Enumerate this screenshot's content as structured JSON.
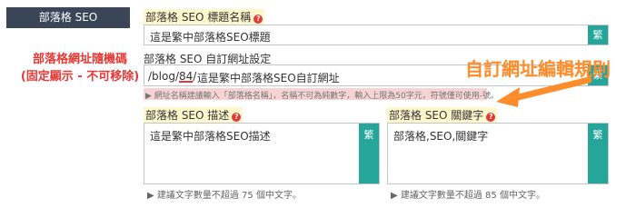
{
  "sidebar": {
    "tab_label": "部落格 SEO",
    "note_line1": "部落格網址隨機碼",
    "note_line2": "(固定顯示 - 不可移除)"
  },
  "title_field": {
    "label": "部落格 SEO 標題名稱",
    "value": "這是繁中部落格SEO標題",
    "button": "繁"
  },
  "url_field": {
    "label": "部落格 SEO 自訂網址設定",
    "prefix_start": "/blog/",
    "prefix_code": "84",
    "prefix_end": "/",
    "value": "這是繁中部落格SEO自訂網址",
    "button": "繁",
    "hint": "▶ 網址名稱建議輸入「部落格名稱」，名稱不可為純數字，輸入上限為50字元，符號僅可使用-號。"
  },
  "annotation": {
    "callout": "自訂網址編輯規則",
    "color": "#ff8c2a"
  },
  "desc_field": {
    "label": "部落格 SEO 描述",
    "value": "這是繁中部落格SEO描述",
    "button": "繁",
    "hint": "▶ 建議文字數量不超過 75 個中文字。"
  },
  "keywords_field": {
    "label": "部落格 SEO 關鍵字",
    "value": "部落格,SEO,關鍵字",
    "button": "繁",
    "hint": "▶ 建議文字數量不超過 85 個中文字。"
  },
  "colors": {
    "accent": "#26a69a",
    "sidebar_bg": "#3a4658",
    "alert": "#e53935",
    "label_highlight": "#fff7cc"
  }
}
